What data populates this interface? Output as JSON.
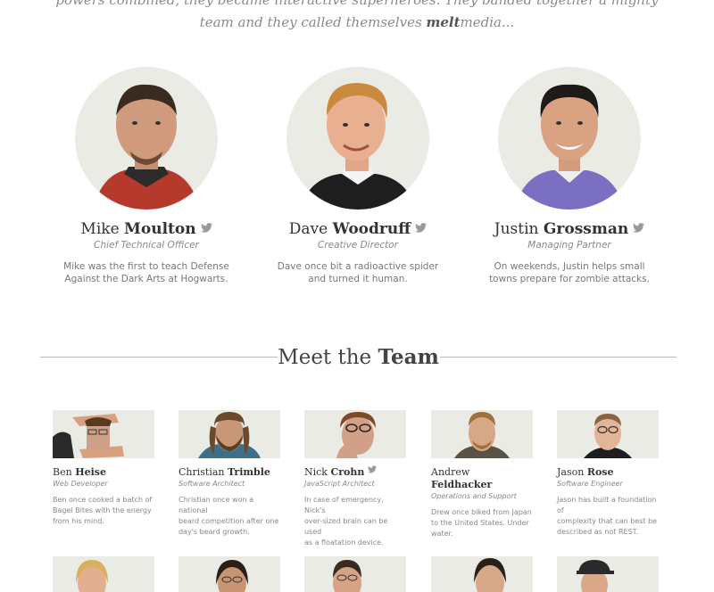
{
  "intro": {
    "line1": "powers combined, they became interactive superheroes. They banded together a mighty",
    "line2_pre": "team and they called themselves ",
    "line2_brand": "melt",
    "line2_post": "media..."
  },
  "partners": [
    {
      "first": "Mike",
      "last": "Moulton",
      "role": "Chief Technical Officer",
      "bio_line1": "Mike was the first to teach Defense",
      "bio_line2": "Against the Dark Arts at Hogwarts."
    },
    {
      "first": "Dave",
      "last": "Woodruff",
      "role": "Creative Director",
      "bio_line1": "Dave once bit a radioactive spider",
      "bio_line2": "and turned it human."
    },
    {
      "first": "Justin",
      "last": "Grossman",
      "role": "Managing Partner",
      "bio_line1": "On weekends, Justin helps small",
      "bio_line2": "towns prepare for zombie attacks."
    }
  ],
  "section": {
    "title_pre": "Meet the ",
    "title_bold": "Team"
  },
  "members": [
    {
      "first": "Ben",
      "last": "Heise",
      "role": "Web Developer",
      "bio": [
        "Ben once cooked a batch of",
        "Bagel Bites with the energy",
        "from his mind."
      ]
    },
    {
      "first": "Christian",
      "last": "Trimble",
      "role": "Software Architect",
      "bio": [
        "Christian once won a national",
        "beard competition after one",
        "day's beard growth."
      ]
    },
    {
      "first": "Nick",
      "last": "Crohn",
      "role": "JavaScript Architect",
      "bio": [
        "In case of emergency, Nick's",
        "over-sized brain can be used",
        "as a floatation device."
      ]
    },
    {
      "first": "Andrew",
      "last": "Feldhacker",
      "role": "Operations and Support",
      "bio": [
        "Drew once biked from Japan",
        "to the United States. Under",
        "water."
      ]
    },
    {
      "first": "Jason",
      "last": "Rose",
      "role": "Software Engineer",
      "bio": [
        "Jason has built a foundation of",
        "complexity that can best be",
        "described as not REST."
      ]
    }
  ],
  "icons": {
    "social": "twitter-icon"
  },
  "colors": {
    "photo_bg": "#ebebe5",
    "text": "#444444",
    "muted": "#888888"
  }
}
